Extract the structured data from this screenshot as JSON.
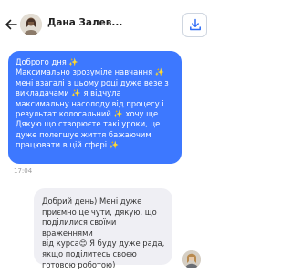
{
  "header": {
    "contact_name": "Дана Залев..."
  },
  "outgoing_message": {
    "lines": [
      "Доброго дня ✨",
      "Максимально зрозуміле навчання ✨",
      "мені взагалі в цьому році дуже везе з",
      "викладачами ✨ я відчула",
      "максимальну насолоду від процесу і",
      "результат колосальний ✨ хочу ще",
      "Дякую що створюєте такі уроки, це",
      "дуже полегшує життя бажаючим",
      "працювати в цій сфері ✨"
    ],
    "time": "17:04"
  },
  "incoming_message": {
    "lines": [
      "Добрий день) Мені дуже",
      "приємно це чути, дякую, що",
      "поділилися своїми враженнями",
      "від курса😊 Я буду дуже рада,",
      "якщо поділитесь своєю",
      "готовою роботою)"
    ]
  },
  "colors": {
    "outgoing_bubble": "#3d78ff",
    "incoming_bubble": "#efeff4"
  }
}
